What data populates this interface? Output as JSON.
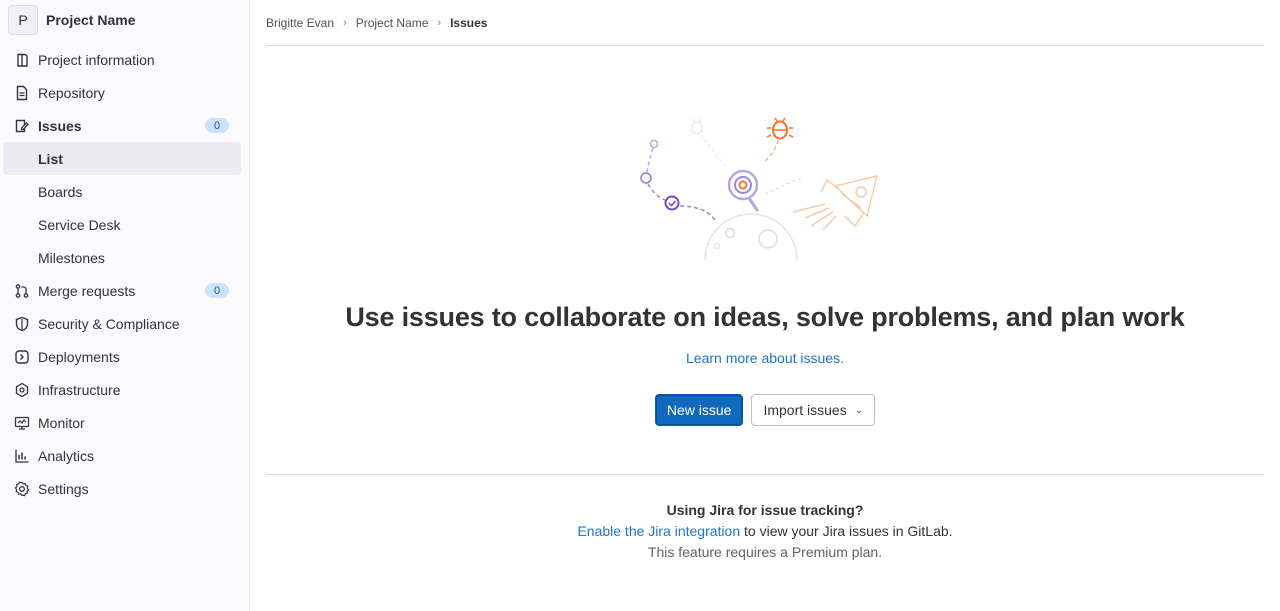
{
  "project": {
    "avatar_letter": "P",
    "name": "Project Name"
  },
  "sidebar": {
    "items": [
      {
        "label": "Project information",
        "icon": "project-information-icon"
      },
      {
        "label": "Repository",
        "icon": "repository-icon"
      },
      {
        "label": "Issues",
        "icon": "issues-icon",
        "badge": "0"
      },
      {
        "label": "List"
      },
      {
        "label": "Boards"
      },
      {
        "label": "Service Desk"
      },
      {
        "label": "Milestones"
      },
      {
        "label": "Merge requests",
        "icon": "merge-request-icon",
        "badge": "0"
      },
      {
        "label": "Security & Compliance",
        "icon": "shield-icon"
      },
      {
        "label": "Deployments",
        "icon": "deployments-icon"
      },
      {
        "label": "Infrastructure",
        "icon": "infrastructure-icon"
      },
      {
        "label": "Monitor",
        "icon": "monitor-icon"
      },
      {
        "label": "Analytics",
        "icon": "analytics-icon"
      },
      {
        "label": "Settings",
        "icon": "gear-icon"
      }
    ]
  },
  "breadcrumb": {
    "user": "Brigitte Evan",
    "project": "Project Name",
    "current": "Issues"
  },
  "empty_state": {
    "title": "Use issues to collaborate on ideas, solve problems, and plan work",
    "learn_link": "Learn more about issues.",
    "new_issue_label": "New issue",
    "import_label": "Import issues"
  },
  "jira": {
    "question": "Using Jira for issue tracking?",
    "link_text": "Enable the Jira integration",
    "link_suffix": " to view your Jira issues in GitLab.",
    "note": "This feature requires a Premium plan."
  },
  "colors": {
    "accent": "#1068bf",
    "link": "#1f75cb",
    "badge_bg": "#cbe2f9",
    "illustration_purple": "#6e49cb",
    "illustration_orange": "#fc6d26"
  }
}
